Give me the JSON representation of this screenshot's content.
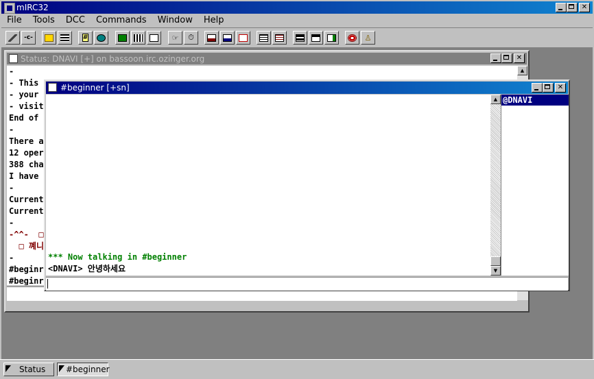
{
  "app": {
    "title": "mIRC32",
    "menu": [
      "File",
      "Tools",
      "DCC",
      "Commands",
      "Window",
      "Help"
    ]
  },
  "toolbar": {
    "icons": [
      "connect-icon",
      "disconnect-icon",
      "folder-icon",
      "options-icon",
      "channels-icon",
      "globe-icon",
      "notify-icon",
      "urls-icon",
      "address-book-icon",
      "ignore-icon",
      "timer-icon",
      "dcc-send-icon",
      "dcc-chat-icon",
      "dcc-list-icon",
      "notify-list-icon",
      "url-list-icon",
      "tile-horizontal-icon",
      "cascade-icon",
      "arrange-icon",
      "help-icon",
      "about-icon"
    ]
  },
  "status_window": {
    "title": "Status: DNAVI [+] on bassoon.irc.ozinger.org",
    "lines": [
      {
        "text": "-",
        "color": "#000000"
      },
      {
        "text": "- This",
        "color": "#000000"
      },
      {
        "text": "- your",
        "color": "#000000"
      },
      {
        "text": "- visit",
        "color": "#000000"
      },
      {
        "text": "End of",
        "color": "#000000"
      },
      {
        "text": "-",
        "color": "#000000"
      },
      {
        "text": "There a",
        "color": "#000000"
      },
      {
        "text": "12 oper",
        "color": "#000000"
      },
      {
        "text": "388 cha",
        "color": "#000000"
      },
      {
        "text": "I have",
        "color": "#000000"
      },
      {
        "text": "-",
        "color": "#000000"
      },
      {
        "text": "Current",
        "color": "#000000"
      },
      {
        "text": "Current",
        "color": "#000000"
      },
      {
        "text": "-",
        "color": "#000000"
      },
      {
        "text": "-^^-  □",
        "color": "#800000"
      },
      {
        "text": "  □ 꼐니",
        "color": "#800000"
      },
      {
        "text": "-",
        "color": "#000000"
      },
      {
        "text": "#beginr",
        "color": "#000000"
      },
      {
        "text": "#beginr",
        "color": "#000000"
      },
      {
        "text": "-",
        "color": "#000000"
      }
    ]
  },
  "channel_window": {
    "title": "#beginner [+sn]",
    "lines": [
      {
        "text": "*** Now talking in #beginner",
        "color": "#008000"
      },
      {
        "text": "<DNAVI> 안녕하세요",
        "color": "#000000"
      }
    ],
    "nicklist": [
      "@DNAVI"
    ]
  },
  "taskbar": {
    "items": [
      "Status",
      "#beginner"
    ]
  },
  "colors": {
    "title_active": "#000080",
    "title_inactive": "#808080",
    "join_text": "#008000"
  }
}
